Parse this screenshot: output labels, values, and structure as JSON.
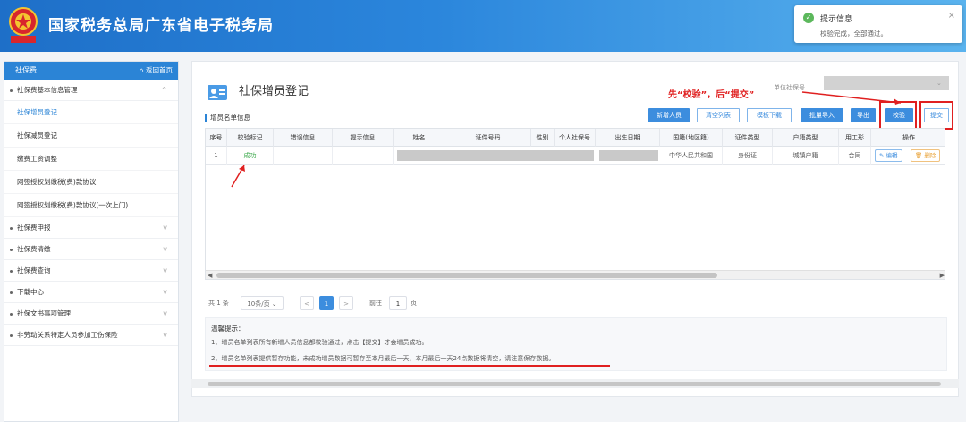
{
  "header": {
    "title": "国家税务总局广东省电子税务局",
    "logo_text": "中国税务"
  },
  "toast": {
    "title": "提示信息",
    "message": "校验完成，全部通过。",
    "close": "×"
  },
  "sidebar": {
    "title": "社保费",
    "home_link": "返回首页",
    "groups": [
      {
        "label": "社保费基本信息管理",
        "chevron": "^"
      },
      {
        "label": "社保费申报",
        "chevron": "v"
      },
      {
        "label": "社保费清缴",
        "chevron": "v"
      },
      {
        "label": "社保费查询",
        "chevron": "v"
      },
      {
        "label": "下载中心",
        "chevron": "v"
      },
      {
        "label": "社保文书事项管理",
        "chevron": "v"
      },
      {
        "label": "非劳动关系特定人员参加工伤保险",
        "chevron": "v"
      }
    ],
    "items": [
      "社保增员登记",
      "社保减员登记",
      "缴费工资调整",
      "网签授权划缴税(费)款协议",
      "网签授权划缴税(费)款协议(一次上门)"
    ]
  },
  "main": {
    "page_title": "社保增员登记",
    "annotation": "先“校验”，后“提交”",
    "unit_label": "单位社保号",
    "list_title": "增员名单信息",
    "buttons": {
      "add": "新增人员",
      "clear": "清空列表",
      "template": "模板下载",
      "import": "批量导入",
      "export": "导出",
      "validate": "校验",
      "submit": "提交"
    },
    "table": {
      "columns": [
        "序号",
        "校验标记",
        "错误信息",
        "提示信息",
        "姓名",
        "证件号码",
        "性别",
        "个人社保号",
        "出生日期",
        "国籍(地区籍)",
        "证件类型",
        "户籍类型",
        "用工形",
        "操作"
      ],
      "rows": [
        {
          "index": "1",
          "status": "成功",
          "nationality": "中华人民共和国",
          "id_type": "身份证",
          "household": "城镇户籍",
          "employment": "合同",
          "edit": "编辑",
          "delete": "删除"
        }
      ]
    },
    "pager": {
      "total": "共 1 条",
      "page_size": "10条/页",
      "prev": "<",
      "current": "1",
      "next": ">",
      "goto_label": "前往",
      "goto_value": "1",
      "goto_suffix": "页"
    },
    "tips": {
      "heading": "温馨提示：",
      "line1": "1、增员名单列表所有新增人员信息都校验通过，点击【提交】才会增员成功。",
      "line2": "2、增员名单列表提供暂存功能，未成功增员数据可暂存至本月最后一天，本月最后一天24点数据将清空，请注意保存数据。"
    }
  },
  "colors": {
    "header_start": "#1e6fc8",
    "accent": "#3c8dde",
    "success": "#3aa84a",
    "annotation_red": "#e02020"
  }
}
